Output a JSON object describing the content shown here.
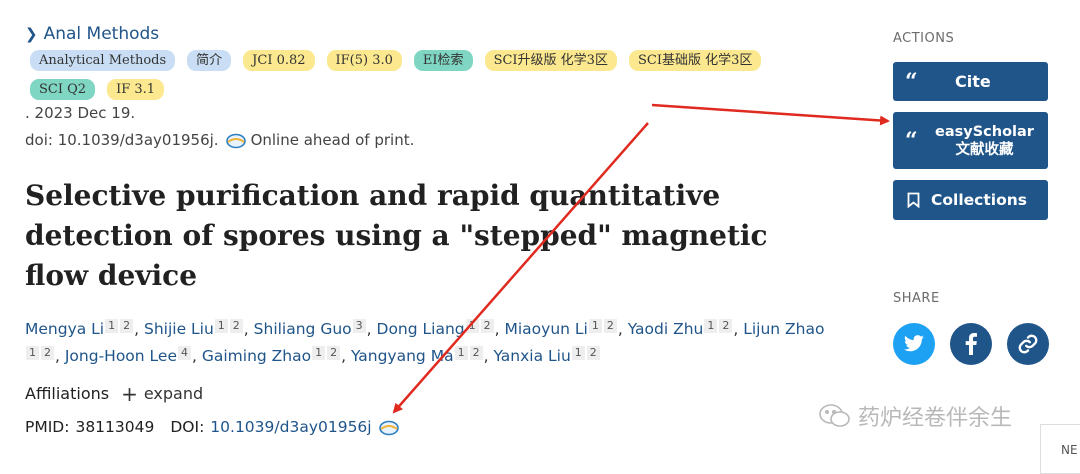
{
  "journal": {
    "name": "Anal Methods"
  },
  "badges": [
    {
      "label": "Analytical Methods",
      "color": "#c9def4"
    },
    {
      "label": "简介",
      "color": "#c9def4"
    },
    {
      "label": "JCI 0.82",
      "color": "#fbe88f"
    },
    {
      "label": "IF(5) 3.0",
      "color": "#fbe88f"
    },
    {
      "label": "EI检索",
      "color": "#7fd6c3"
    },
    {
      "label": "SCI升级版 化学3区",
      "color": "#fbe88f"
    },
    {
      "label": "SCI基础版 化学3区",
      "color": "#fbe88f"
    },
    {
      "label": "SCI Q2",
      "color": "#7fd6c3"
    },
    {
      "label": "IF 3.1",
      "color": "#fbe88f"
    }
  ],
  "meta": {
    "date": ". 2023 Dec 19.",
    "doi_text": "doi: 10.1039/d3ay01956j.",
    "status": "Online ahead of print."
  },
  "article": {
    "title": "Selective purification and rapid quantitative detection of spores using a \"stepped\" magnetic flow device"
  },
  "authors": [
    {
      "name": "Mengya Li",
      "aff": [
        "1",
        "2"
      ]
    },
    {
      "name": "Shijie Liu",
      "aff": [
        "1",
        "2"
      ]
    },
    {
      "name": "Shiliang Guo",
      "aff": [
        "3"
      ]
    },
    {
      "name": "Dong Liang",
      "aff": [
        "1",
        "2"
      ]
    },
    {
      "name": "Miaoyun Li",
      "aff": [
        "1",
        "2"
      ]
    },
    {
      "name": "Yaodi Zhu",
      "aff": [
        "1",
        "2"
      ]
    },
    {
      "name": "Lijun Zhao",
      "aff": [
        "1",
        "2"
      ]
    },
    {
      "name": "Jong-Hoon Lee",
      "aff": [
        "4"
      ]
    },
    {
      "name": "Gaiming Zhao",
      "aff": [
        "1",
        "2"
      ]
    },
    {
      "name": "Yangyang Ma",
      "aff": [
        "1",
        "2"
      ]
    },
    {
      "name": "Yanxia Liu",
      "aff": [
        "1",
        "2"
      ]
    }
  ],
  "affiliations": {
    "label": "Affiliations",
    "expand": "expand"
  },
  "ids": {
    "pmid_label": "PMID:",
    "pmid": "38113049",
    "doi_label": "DOI:",
    "doi": "10.1039/d3ay01956j"
  },
  "sidebar": {
    "actions_label": "ACTIONS",
    "cite_label": "Cite",
    "easyscholar_line1": "easyScholar",
    "easyscholar_line2": "文献收藏",
    "collections_label": "Collections",
    "share_label": "SHARE",
    "share_icons": [
      "twitter-icon",
      "facebook-icon",
      "link-icon"
    ]
  },
  "watermark": {
    "text": "药炉经卷伴余生"
  },
  "corner_tab": {
    "label": "NE"
  },
  "colors": {
    "link": "#20558a",
    "button": "#20558a",
    "twitter": "#1da1f2",
    "facebook": "#20558a",
    "arrow": "#e02a1f"
  }
}
